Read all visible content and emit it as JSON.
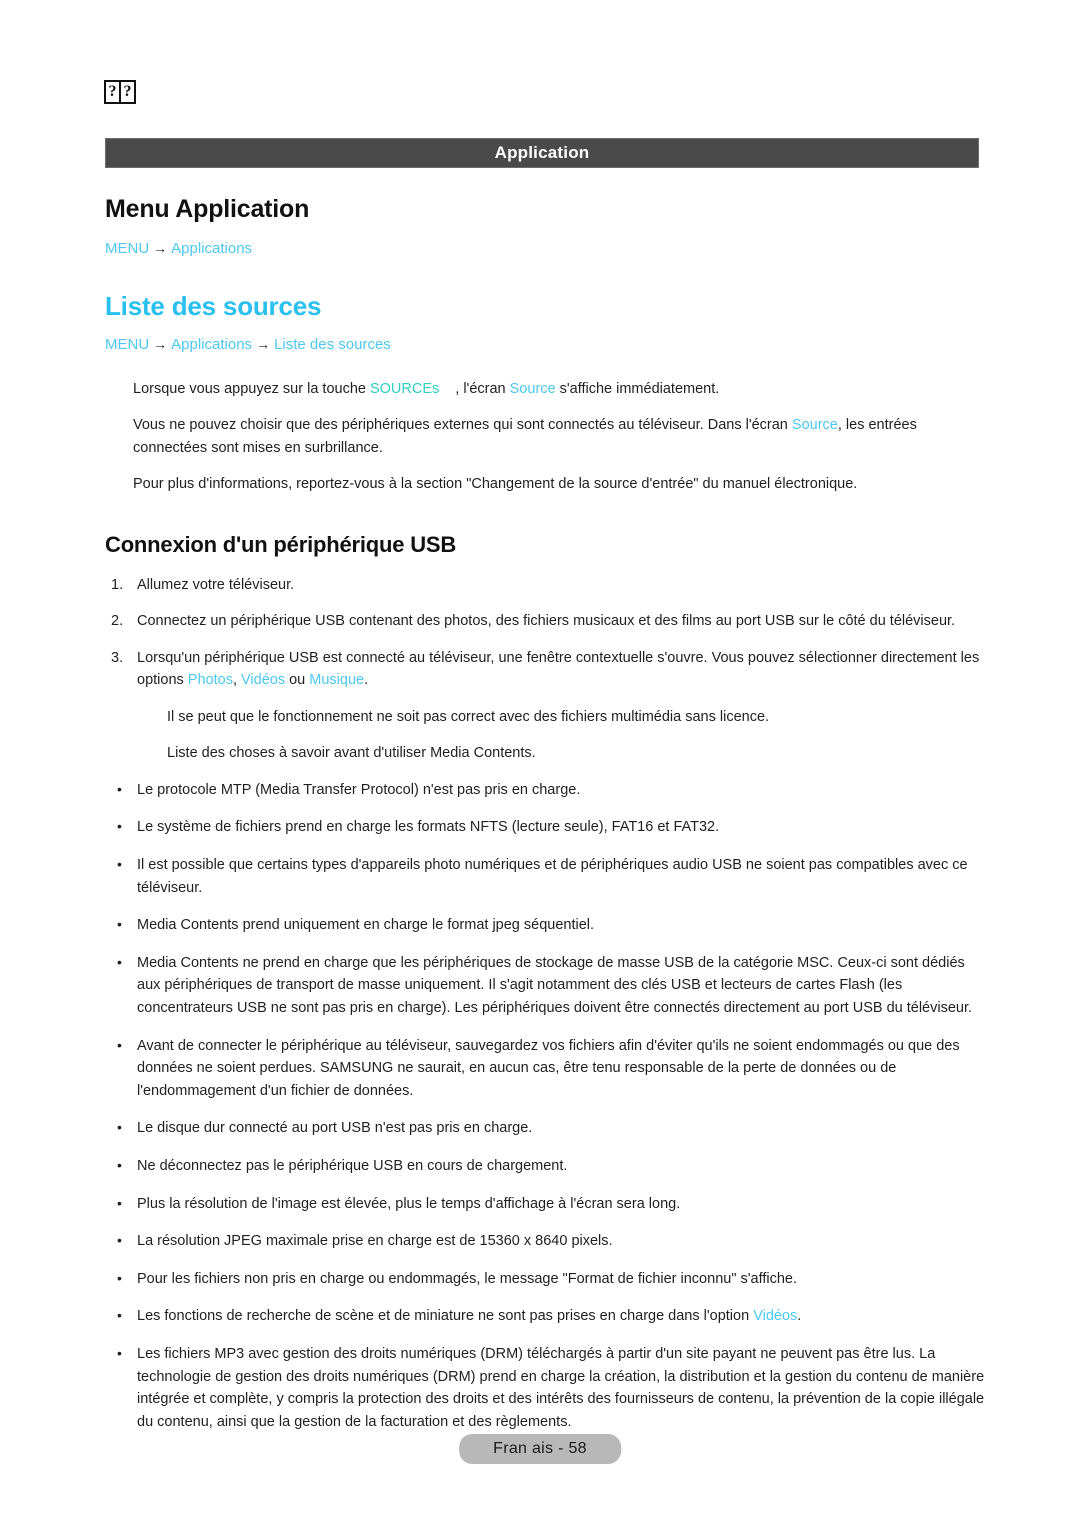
{
  "tofu_marks": [
    "?",
    "?"
  ],
  "header": {
    "band_title": "Application"
  },
  "section": {
    "title": "Menu Application",
    "breadcrumb_1": {
      "menu": "MENU",
      "arrow": "→",
      "applications": "Applications"
    }
  },
  "sources": {
    "title": "Liste des sources",
    "breadcrumb_2": {
      "menu": "MENU",
      "arrow1": "→",
      "applications": "Applications",
      "arrow2": "→",
      "liste": "Liste des sources"
    },
    "para1_pre": "Lorsque vous appuyez sur la touche ",
    "para1_key": "SOURCEs",
    "para1_mid": ", l'écran ",
    "para1_link": "Source",
    "para1_post": " s'affiche immédiatement.",
    "para2_pre": "Vous ne pouvez choisir que des périphériques externes qui sont connectés au téléviseur. Dans l'écran ",
    "para2_link": "Source",
    "para2_post": ", les entrées connectées sont mises en surbrillance.",
    "para3": "Pour plus d'informations, reportez-vous à la section \"Changement de la source d'entrée\" du manuel électronique."
  },
  "usb": {
    "title": "Connexion d'un périphérique USB",
    "steps": [
      {
        "num": "1.",
        "text": "Allumez votre téléviseur."
      },
      {
        "num": "2.",
        "text": "Connectez un périphérique USB contenant des photos, des fichiers musicaux et des films au port USB sur le côté du téléviseur."
      }
    ],
    "step3": {
      "num": "3.",
      "pre": "Lorsqu'un périphérique USB est connecté au téléviseur, une fenêtre contextuelle s'ouvre. Vous pouvez sélectionner directement les options ",
      "link_photos": "Photos",
      "sep1": ", ",
      "link_videos": "Vidéos",
      "sep2": " ou ",
      "link_musique": "Musique",
      "post": "."
    },
    "note1": "Il se peut que le fonctionnement ne soit pas correct avec des fichiers multimédia sans licence.",
    "note2": "Liste des choses à savoir avant d'utiliser Media Contents.",
    "bullet_char": "•",
    "bullets": [
      "Le protocole MTP (Media Transfer Protocol) n'est pas pris en charge.",
      "Le système de fichiers prend en charge les formats NFTS (lecture seule), FAT16 et FAT32.",
      "Il est possible que certains types d'appareils photo numériques et de périphériques audio USB ne soient pas compatibles avec ce téléviseur.",
      "Media Contents prend uniquement en charge le format jpeg séquentiel.",
      "Media Contents ne prend en charge que les périphériques de stockage de masse USB de la catégorie MSC. Ceux-ci sont dédiés aux périphériques de transport de masse uniquement. Il s'agit notamment des clés USB et lecteurs de cartes Flash (les concentrateurs USB ne sont pas pris en charge). Les périphériques doivent être connectés directement au port USB du téléviseur.",
      "Avant de connecter le périphérique au téléviseur, sauvegardez vos fichiers afin d'éviter qu'ils ne soient endommagés ou que des données ne soient perdues. SAMSUNG ne saurait, en aucun cas, être tenu responsable de la perte de données ou de l'endommagement d'un fichier de données.",
      "Le disque dur connecté au port USB n'est pas pris en charge.",
      "Ne déconnectez pas le périphérique USB en cours de chargement.",
      "Plus la résolution de l'image est élevée, plus le temps d'affichage à l'écran sera long.",
      "La résolution JPEG maximale prise en charge est de 15360 x 8640 pixels.",
      "Pour les fichiers non pris en charge ou endommagés, le message \"Format de fichier inconnu\" s'affiche."
    ],
    "bullet_videos": {
      "pre": "Les fonctions de recherche de scène et de miniature ne sont pas prises en charge dans l'option ",
      "link": "Vidéos",
      "post": "."
    },
    "bullet_drm": "Les fichiers MP3 avec gestion des droits numériques (DRM) téléchargés à partir d'un site payant ne peuvent pas être lus. La technologie de gestion des droits numériques (DRM) prend en charge la création, la distribution et la gestion du contenu de manière intégrée et complète, y compris la protection des droits et des intérêts des fournisseurs de contenu, la prévention de la copie illégale du contenu, ainsi que la gestion de la facturation et des règlements."
  },
  "footer": {
    "page_label": "Fran ais - 58"
  },
  "colors": {
    "link_cyan": "#4dc8f0",
    "heading_cyan": "#29c0f0",
    "key_teal": "#2ccfc4",
    "band_gray": "#4a4a4a",
    "footer_gray": "#b8b8b8"
  }
}
